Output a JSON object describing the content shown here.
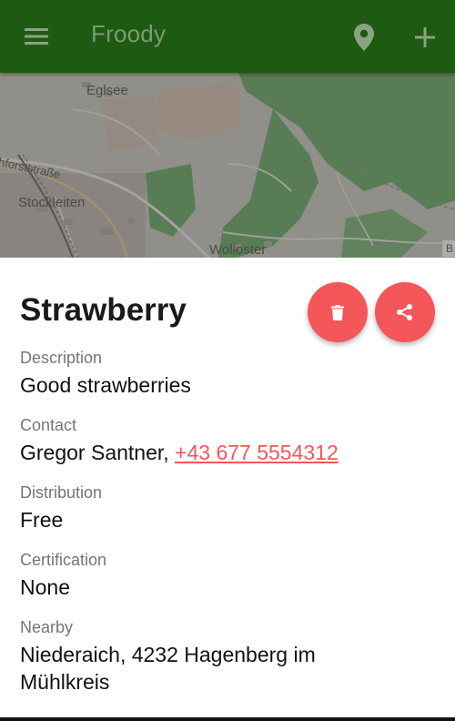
{
  "app_bar": {
    "title": "Froody",
    "background_color": "#1f5a12",
    "menu_icon": "hamburger-menu-icon",
    "location_icon": "map-pin-icon",
    "add_icon": "plus-icon"
  },
  "map": {
    "labels": {
      "eglsee": "Eglsee",
      "street": "hforststraße",
      "stockleiten": "Stockleiten",
      "wolloster": "Wolloster",
      "edge": "B"
    }
  },
  "detail": {
    "title": "Strawberry",
    "actions": {
      "delete_icon": "trash-icon",
      "share_icon": "share-icon",
      "button_color": "#f55659"
    },
    "fields": [
      {
        "label": "Description",
        "value": "Good strawberries"
      },
      {
        "label": "Contact",
        "value": "Gregor Santner, ",
        "link": "+43 677 5554312"
      },
      {
        "label": "Distribution",
        "value": "Free"
      },
      {
        "label": "Certification",
        "value": "None"
      },
      {
        "label": "Nearby",
        "value": "Niederaich, 4232 Hagenberg im Mühlkreis"
      }
    ]
  }
}
